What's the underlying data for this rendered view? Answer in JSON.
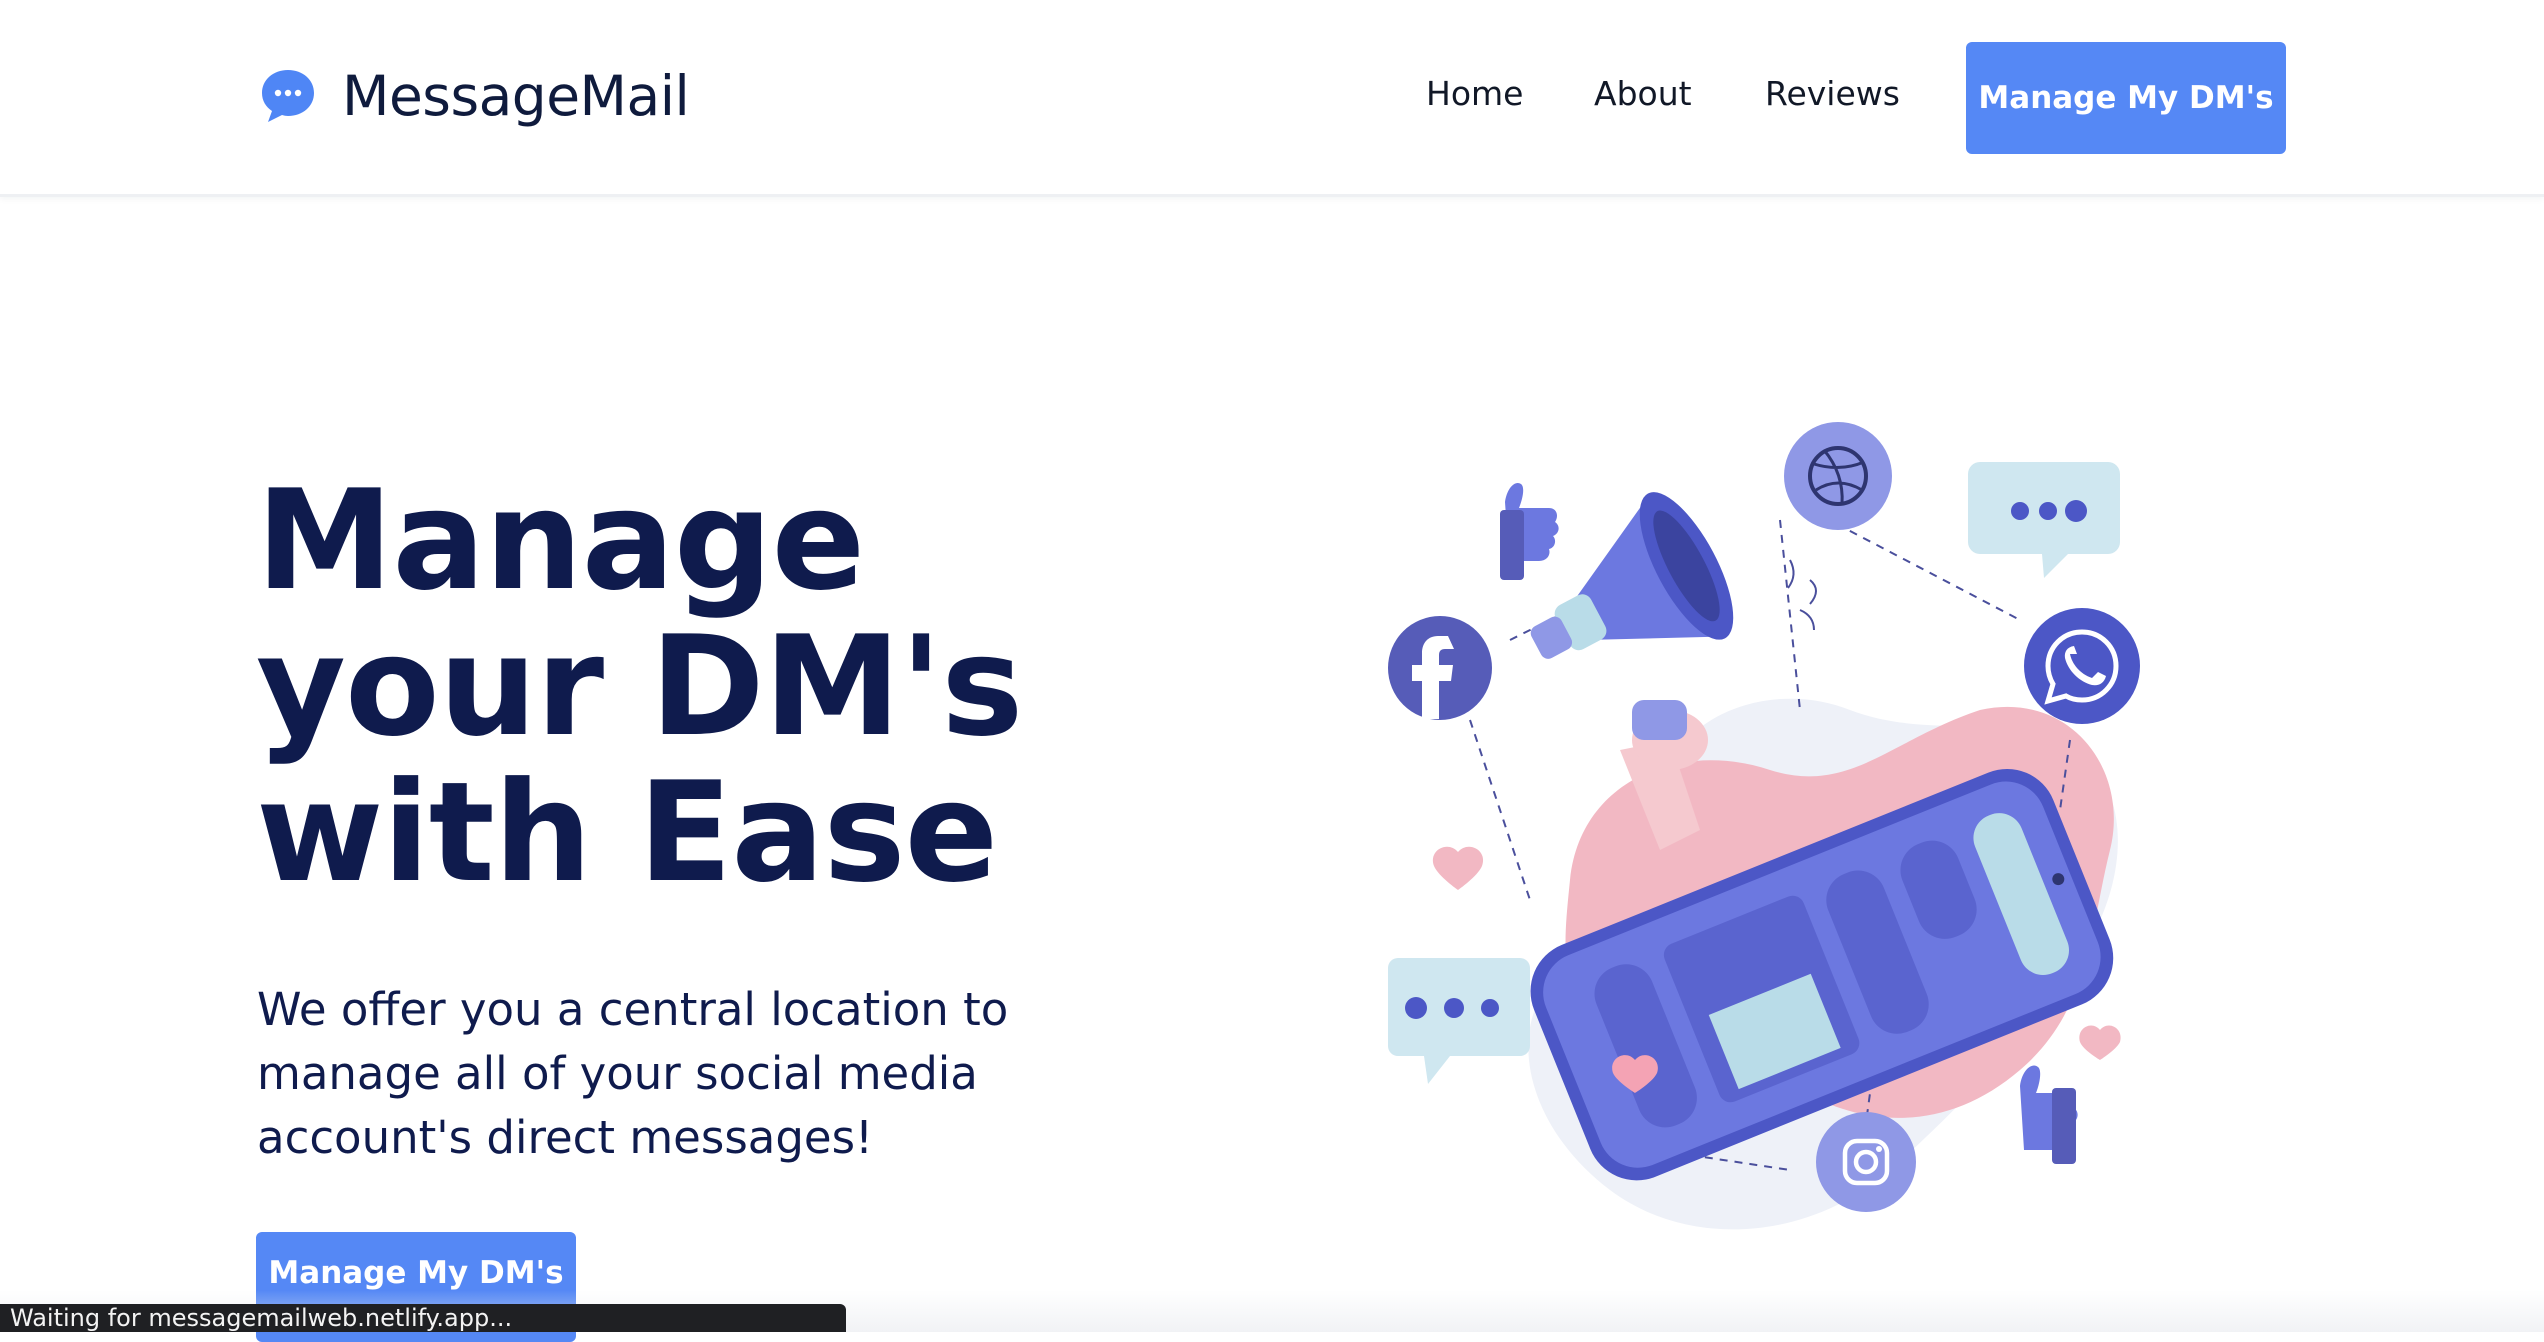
{
  "header": {
    "brand_icon": "chat-bubble-icon",
    "brand_name": "MessageMail",
    "nav": [
      {
        "label": "Home"
      },
      {
        "label": "About"
      },
      {
        "label": "Reviews"
      }
    ],
    "cta_label": "Manage My DM's"
  },
  "hero": {
    "title_lines": [
      "Manage",
      "your DM's",
      "with Ease"
    ],
    "subtitle": "We offer you a central location to manage all of your social media account's direct messages!",
    "cta_label": "Manage My DM's"
  },
  "illustration": {
    "icons": [
      "megaphone-icon",
      "phone-icon",
      "facebook-icon",
      "dribbble-icon",
      "whatsapp-icon",
      "instagram-icon",
      "thumbs-up-icon",
      "heart-icon",
      "chat-bubble-icon"
    ]
  },
  "status_bar": {
    "text": "Waiting for messagemailweb.netlify.app..."
  },
  "colors": {
    "accent": "#5588f5",
    "heading": "#0f1b4d",
    "illustration_purple": "#6b74d9",
    "illustration_pink": "#f2b8c3"
  }
}
